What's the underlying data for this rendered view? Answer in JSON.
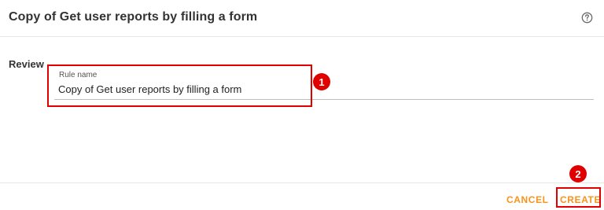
{
  "dialog": {
    "title": "Copy of Get user reports by filling a form",
    "help_icon": "help-circle-icon"
  },
  "form": {
    "section_label": "Review",
    "rule_name": {
      "label": "Rule name",
      "value": "Copy of Get user reports by filling a form"
    }
  },
  "annotations": {
    "step1": "1",
    "step2": "2",
    "highlight_color": "#e00000"
  },
  "footer": {
    "cancel_label": "CANCEL",
    "create_label": "CREATE",
    "button_color": "#f7941d"
  }
}
